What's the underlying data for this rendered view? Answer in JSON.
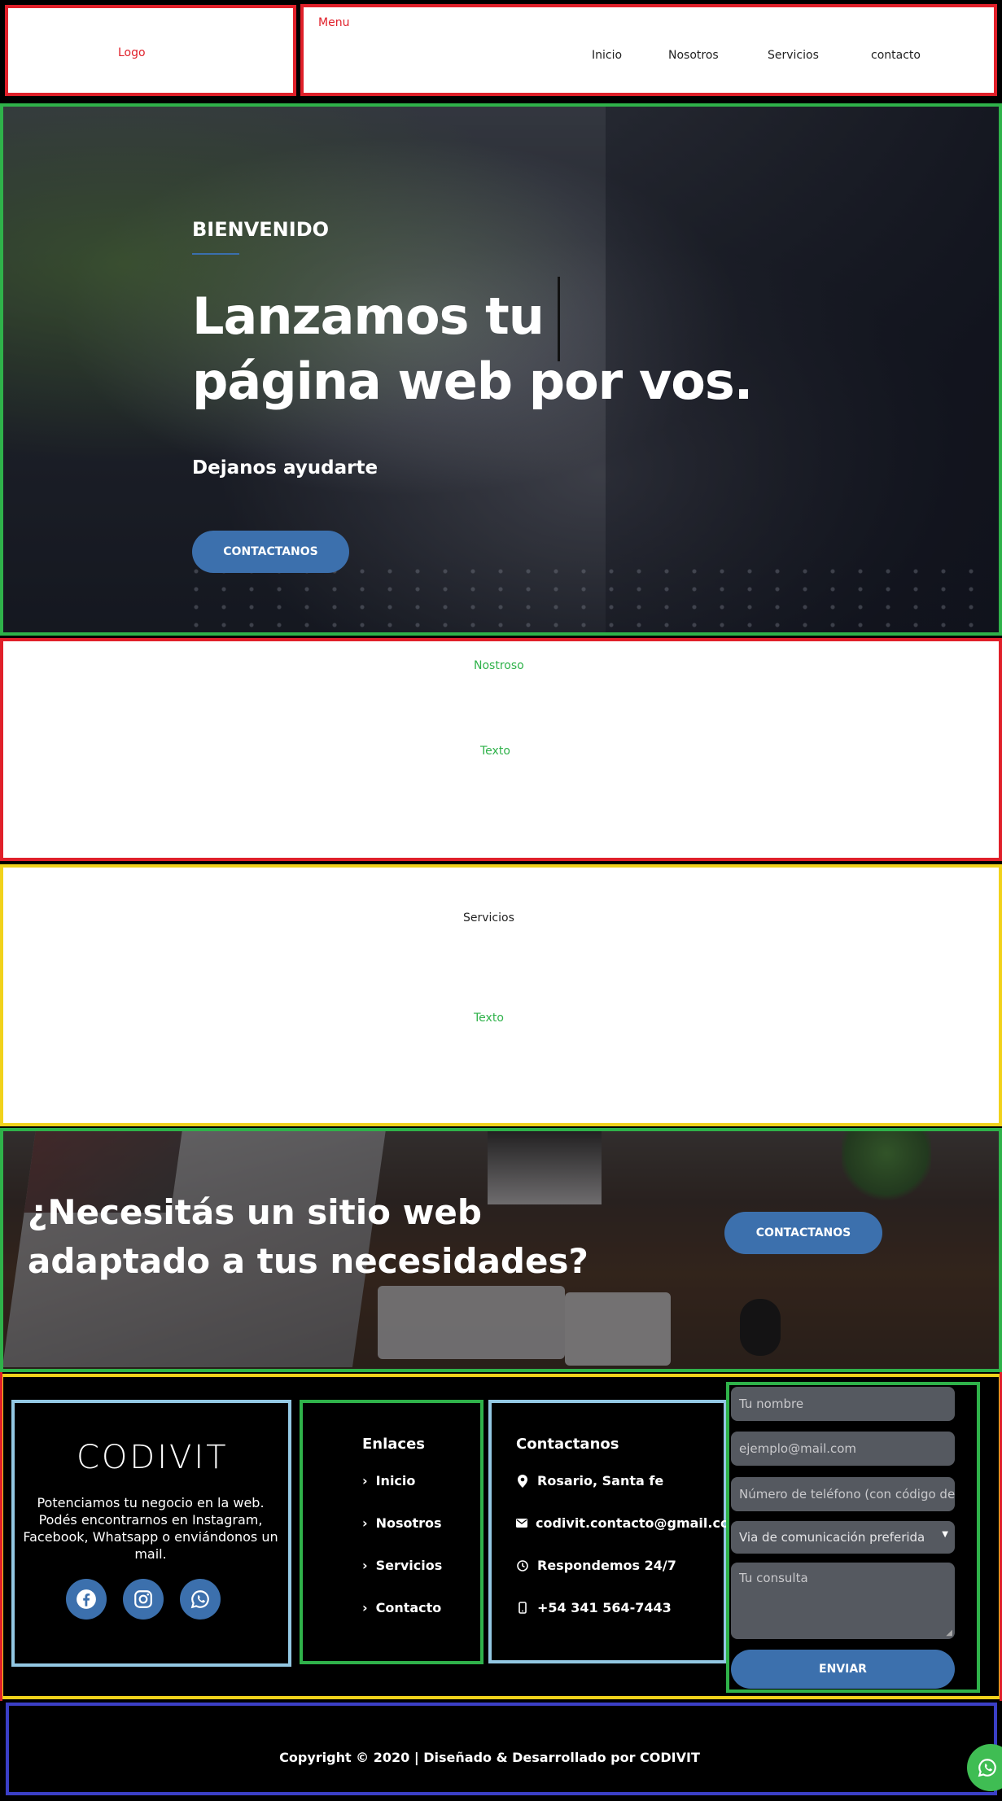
{
  "header": {
    "logo": "Logo",
    "menu_label": "Menu",
    "nav": [
      "Inicio",
      "Nosotros",
      "Servicios",
      "contacto"
    ]
  },
  "hero": {
    "kicker": "BIENVENIDO",
    "title_line1": "Lanzamos tu",
    "title_line2": "página web por vos.",
    "subtitle": "Dejanos ayudarte",
    "button": "CONTACTANOS"
  },
  "nosotros": {
    "heading": "Nostroso",
    "text": "Texto"
  },
  "servicios": {
    "heading": "Servicios",
    "text": "Texto"
  },
  "cta": {
    "title": "¿Necesitás un sitio web adaptado a tus necesidades?",
    "button": "CONTACTANOS"
  },
  "footer": {
    "brand": {
      "logo": "CODIVIT",
      "description": "Potenciamos tu negocio en la web. Podés encontrarnos en Instagram, Facebook, Whatsapp o enviándonos un mail."
    },
    "links": {
      "heading": "Enlaces",
      "items": [
        "Inicio",
        "Nosotros",
        "Servicios",
        "Contacto"
      ]
    },
    "contact": {
      "heading": "Contactanos",
      "location": "Rosario, Santa fe",
      "email": "codivit.contacto@gmail.com",
      "hours": "Respondemos 24/7",
      "phone": "+54 341 564-7443"
    },
    "form": {
      "name_placeholder": "Tu nombre",
      "email_placeholder": "ejemplo@mail.com",
      "phone_placeholder": "Número de teléfono (con código de área)",
      "channel_selected": "Via de comunicación preferida",
      "message_placeholder": "Tu consulta",
      "submit": "ENVIAR"
    }
  },
  "copyright": "Copyright © 2020 | Diseñado & Desarrollado por CODIVIT",
  "colors": {
    "accent_blue": "#3c70ad",
    "outline_red": "#e0202a",
    "outline_green": "#2fb24a",
    "outline_yellow": "#f1d21b",
    "outline_lightblue": "#93c8e3",
    "outline_indigo": "#3b3fc6",
    "whatsapp_green": "#3fbd53"
  }
}
